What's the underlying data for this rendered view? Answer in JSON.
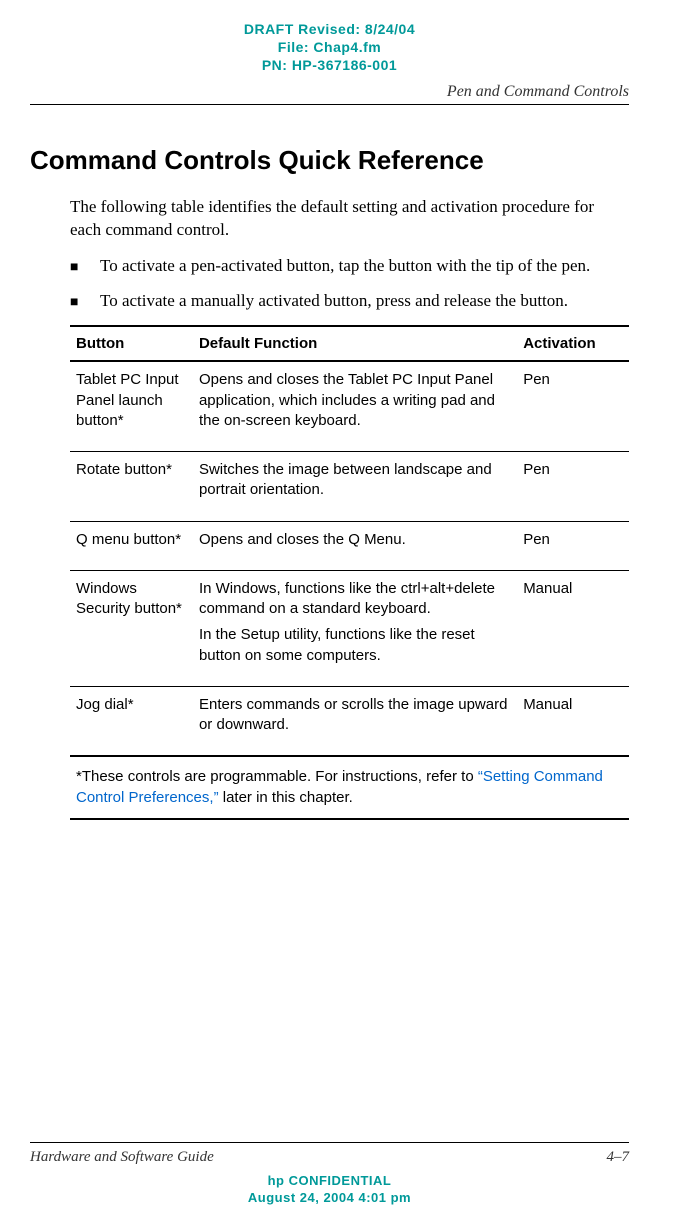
{
  "draft_header": {
    "line1": "DRAFT Revised: 8/24/04",
    "line2": "File: Chap4.fm",
    "line3": "PN: HP-367186-001"
  },
  "section_name": "Pen and Command Controls",
  "heading": "Command Controls Quick Reference",
  "intro": "The following table identifies the default setting and activation procedure for each command control.",
  "bullets": [
    "To activate a pen-activated button, tap the button with the tip of the pen.",
    "To activate a manually activated button, press and release the button."
  ],
  "table": {
    "headers": {
      "button": "Button",
      "function": "Default Function",
      "activation": "Activation"
    },
    "rows": [
      {
        "button": "Tablet PC Input Panel launch button*",
        "function": "Opens and closes the Tablet PC Input Panel application, which includes a writing pad and the on-screen keyboard.",
        "activation": "Pen"
      },
      {
        "button": "Rotate button*",
        "function": "Switches the image between landscape and portrait orientation.",
        "activation": "Pen"
      },
      {
        "button": "Q menu button*",
        "function": "Opens and closes the Q Menu.",
        "activation": "Pen"
      },
      {
        "button": "Windows Security button*",
        "function_p1": "In Windows, functions like the ctrl+alt+delete command on a standard keyboard.",
        "function_p2": "In the Setup utility, functions like the reset button on some computers.",
        "activation": "Manual"
      },
      {
        "button": "Jog dial*",
        "function": "Enters commands or scrolls the image upward or downward.",
        "activation": "Manual"
      }
    ],
    "footnote_prefix": "*These controls are programmable. For instructions, refer to ",
    "footnote_link": "“Setting Command Control Preferences,”",
    "footnote_suffix": " later in this chapter."
  },
  "footer": {
    "guide_name": "Hardware and Software Guide",
    "page_num": "4–7",
    "conf_line1": "hp CONFIDENTIAL",
    "conf_line2": "August 24, 2004 4:01 pm"
  }
}
